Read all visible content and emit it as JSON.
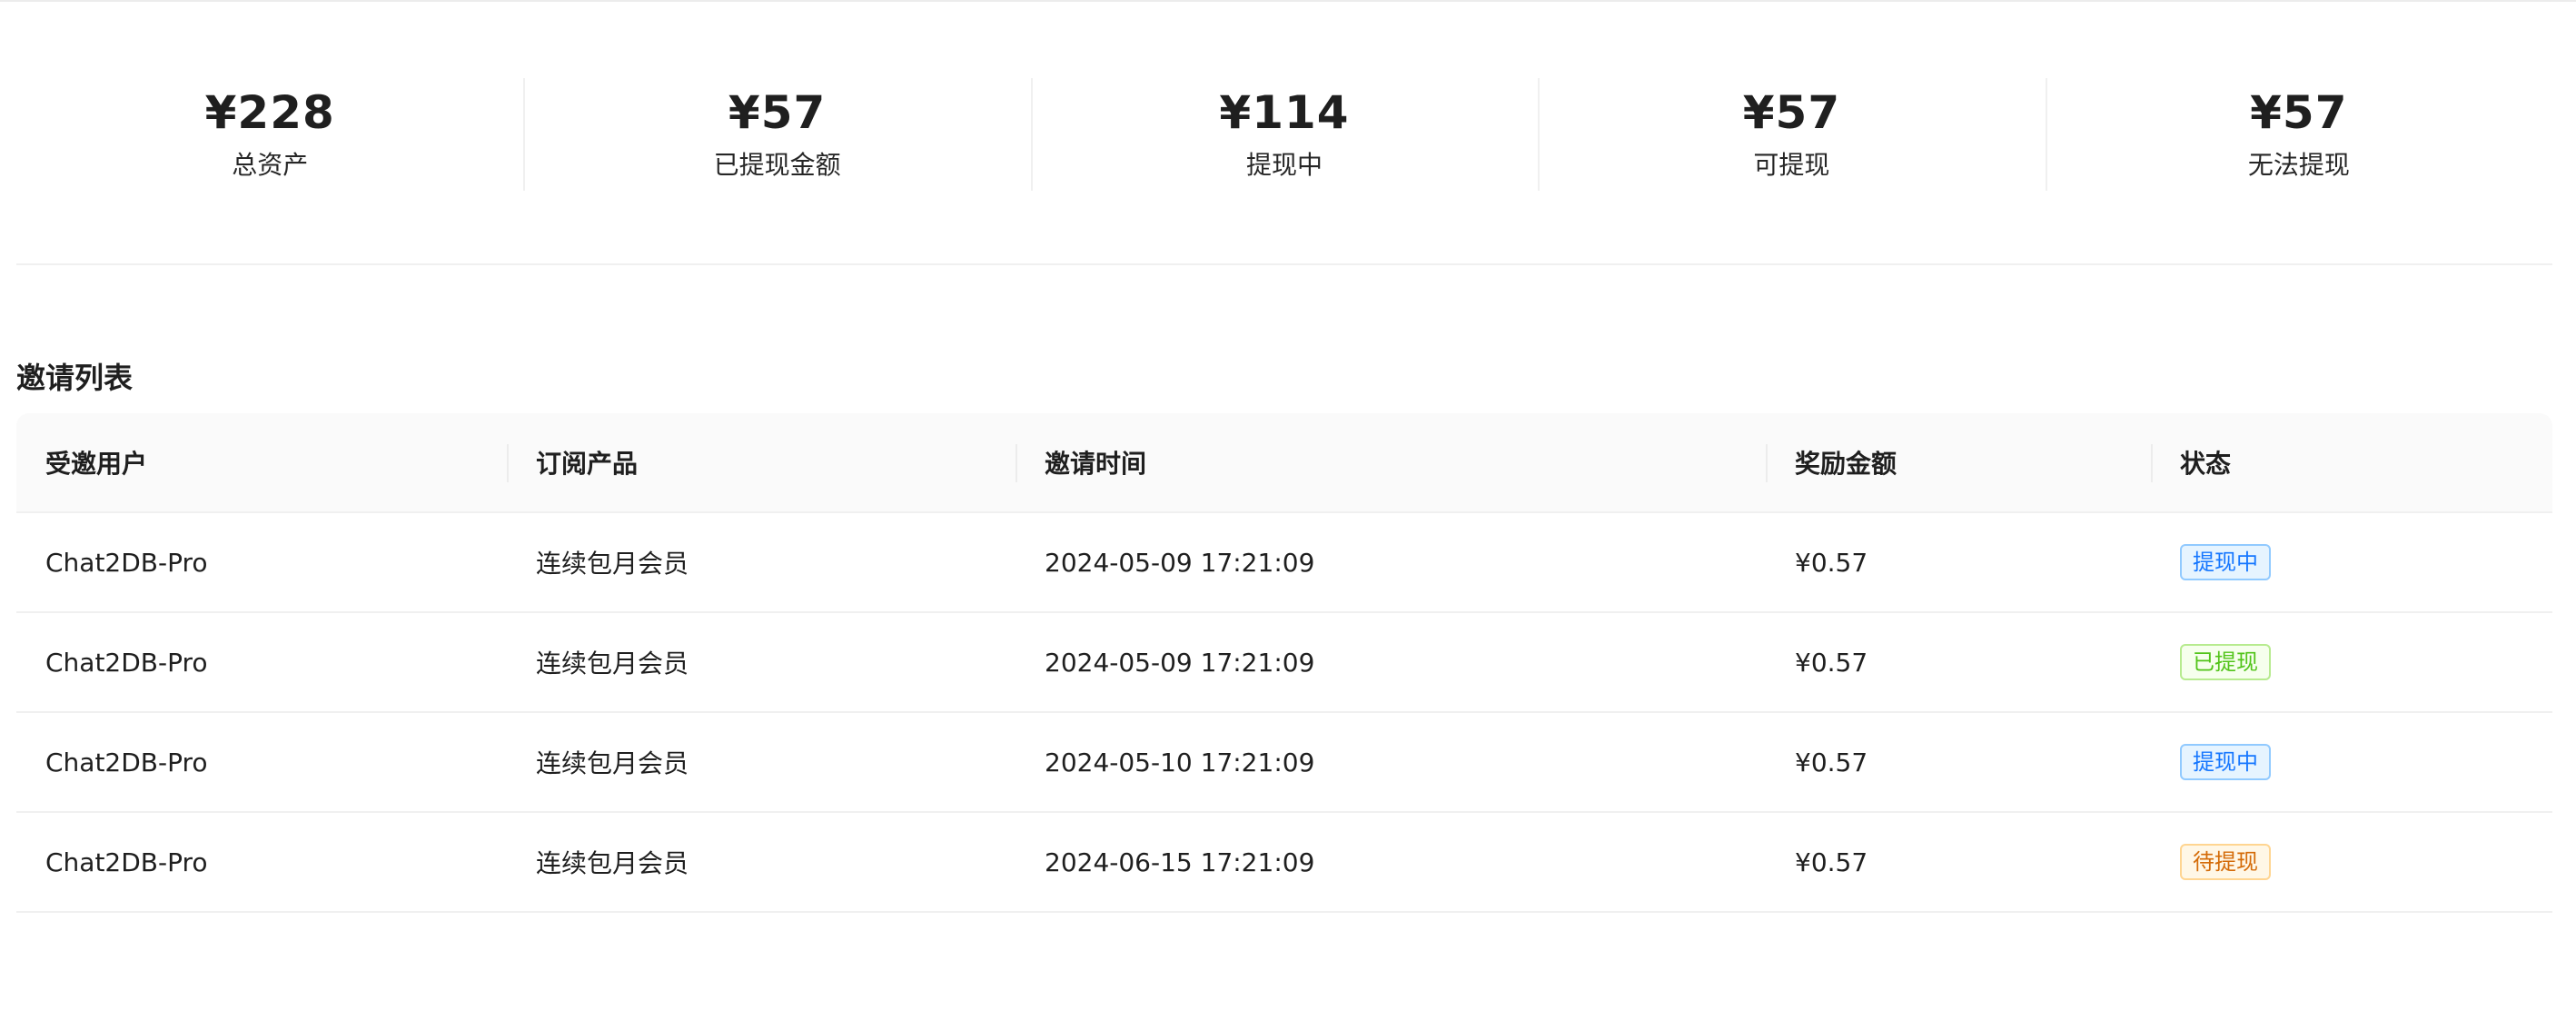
{
  "stats": [
    {
      "value": "¥228",
      "label": "总资产"
    },
    {
      "value": "¥57",
      "label": "已提现金额"
    },
    {
      "value": "¥114",
      "label": "提现中"
    },
    {
      "value": "¥57",
      "label": "可提现"
    },
    {
      "value": "¥57",
      "label": "无法提现"
    }
  ],
  "invite_section": {
    "title": "邀请列表",
    "columns": [
      "受邀用户",
      "订阅产品",
      "邀请时间",
      "奖励金额",
      "状态"
    ],
    "rows": [
      {
        "user": "Chat2DB-Pro",
        "product": "连续包月会员",
        "time": "2024-05-09 17:21:09",
        "reward": "¥0.57",
        "status": "提现中",
        "status_color": "#1677ff"
      },
      {
        "user": "Chat2DB-Pro",
        "product": "连续包月会员",
        "time": "2024-05-09 17:21:09",
        "reward": "¥0.57",
        "status": "已提现",
        "status_color": "#52c41a"
      },
      {
        "user": "Chat2DB-Pro",
        "product": "连续包月会员",
        "time": "2024-05-10 17:21:09",
        "reward": "¥0.57",
        "status": "提现中",
        "status_color": "#1677ff"
      },
      {
        "user": "Chat2DB-Pro",
        "product": "连续包月会员",
        "time": "2024-06-15 17:21:09",
        "reward": "¥0.57",
        "status": "待提现",
        "status_color": "#d46b08"
      }
    ]
  }
}
